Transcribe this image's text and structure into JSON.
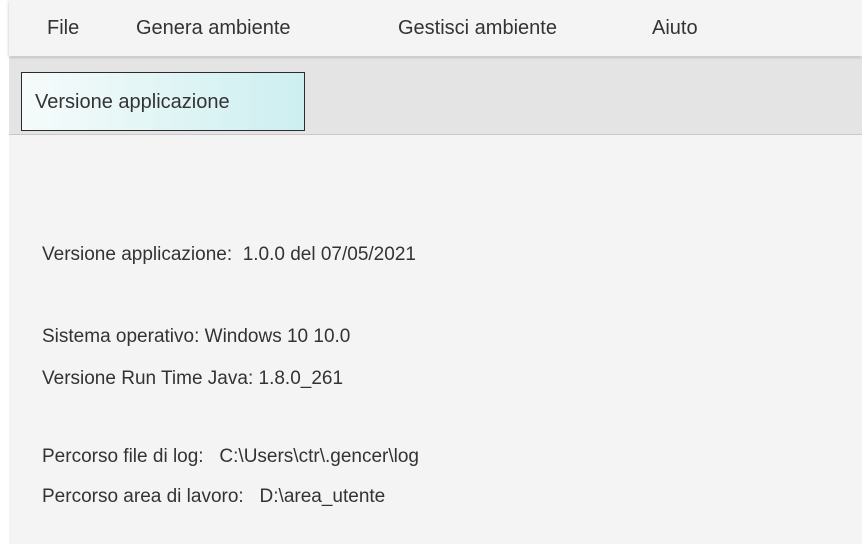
{
  "menu": {
    "file": "File",
    "genera_ambiente": "Genera ambiente",
    "gestisci_ambiente": "Gestisci ambiente",
    "aiuto": "Aiuto"
  },
  "tabs": [
    {
      "label": "Versione applicazione",
      "selected": true
    }
  ],
  "info": {
    "versione_applicazione": "Versione applicazione:  1.0.0 del 07/05/2021",
    "sistema_operativo": "Sistema operativo: Windows 10 10.0",
    "versione_java": "Versione Run Time Java: 1.8.0_261",
    "percorso_log": "Percorso file di log:   C:\\Users\\ctr\\.gencer\\log",
    "percorso_area_lavoro": "Percorso area di lavoro:   D:\\area_utente"
  },
  "colors": {
    "background": "#f4f4f4",
    "tab_bar": "#e4e4e4",
    "tab_selected_gradient_end": "#cdeff0",
    "text": "#333333"
  }
}
